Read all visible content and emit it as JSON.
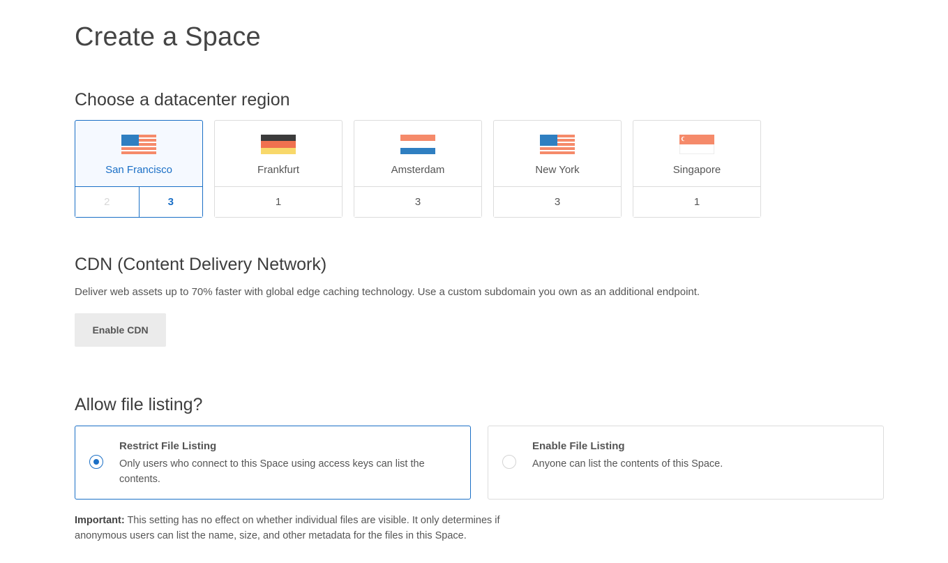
{
  "page": {
    "title": "Create a Space"
  },
  "region": {
    "section_title": "Choose a datacenter region",
    "items": [
      {
        "name": "San Francisco",
        "flag": "us-flag",
        "datacenters": [
          "2",
          "3"
        ],
        "selected_datacenter": "3",
        "disabled_datacenters": [
          "2"
        ],
        "selected": true
      },
      {
        "name": "Frankfurt",
        "flag": "de-flag",
        "datacenters": [
          "1"
        ],
        "selected": false
      },
      {
        "name": "Amsterdam",
        "flag": "nl-flag",
        "datacenters": [
          "3"
        ],
        "selected": false
      },
      {
        "name": "New York",
        "flag": "us-flag",
        "datacenters": [
          "3"
        ],
        "selected": false
      },
      {
        "name": "Singapore",
        "flag": "sg-flag",
        "datacenters": [
          "1"
        ],
        "selected": false
      }
    ]
  },
  "cdn": {
    "section_title": "CDN (Content Delivery Network)",
    "description": "Deliver web assets up to 70% faster with global edge caching technology. Use a custom subdomain you own as an additional endpoint.",
    "button_label": "Enable CDN"
  },
  "listing": {
    "section_title": "Allow file listing?",
    "options": [
      {
        "title": "Restrict File Listing",
        "description": "Only users who connect to this Space using access keys can list the contents.",
        "selected": true
      },
      {
        "title": "Enable File Listing",
        "description": "Anyone can list the contents of this Space.",
        "selected": false
      }
    ],
    "important_label": "Important:",
    "important_text": " This setting has no effect on whether individual files are visible. It only determines if anonymous users can list the name, size, and other metadata for the files in this Space."
  },
  "colors": {
    "accent": "#1a6fc6",
    "selected_bg": "#f5f9ff",
    "button_bg": "#ebebeb",
    "border": "#dcdcdc"
  }
}
